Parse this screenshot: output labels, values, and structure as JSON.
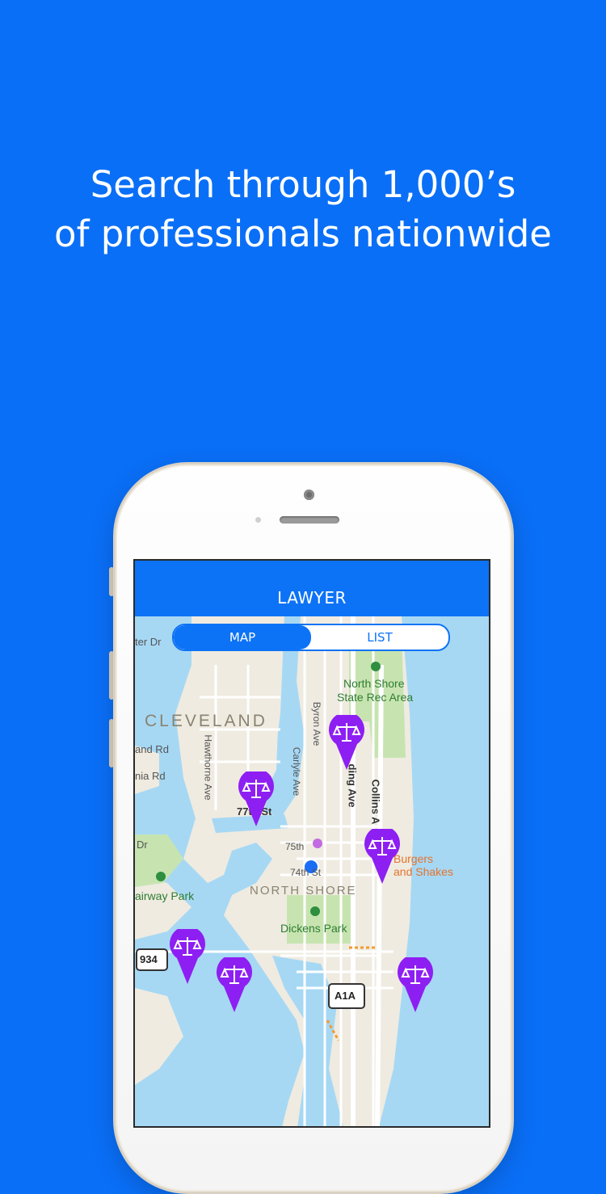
{
  "headline": {
    "line1": "Search through 1,000’s",
    "line2": "of professionals nationwide"
  },
  "app": {
    "title": "LAWYER",
    "segments": [
      {
        "label": "MAP",
        "selected": true
      },
      {
        "label": "LIST",
        "selected": false
      }
    ]
  },
  "map": {
    "labels": {
      "cleveland": "CLEVELAND",
      "north_shore": "NORTH SHORE",
      "park_north_shore": "North Shore",
      "park_state_rec": "State Rec Area",
      "dickens_park": "Dickens Park",
      "fairway_park": "airway Park",
      "burgers_1": "Burgers",
      "burgers_2": "and Shakes",
      "hawthorne": "Hawthorne Ave",
      "carlyle": "Carlyle Ave",
      "byron": "Byron Ave",
      "harding": "ding Ave",
      "collins": "Collins A",
      "st_77": "77th St",
      "st_75": "75th",
      "st_74": "74th St",
      "ter_dr": "ter Dr",
      "and_rd": "and Rd",
      "nia_rd": "nia Rd",
      "dr_left": "Dr",
      "shield_934": "934",
      "shield_a1a": "A1A"
    },
    "pin_icon": "scales-of-justice-icon",
    "pin_color": "#8e1ff2",
    "user_location_color": "#1a6ef5",
    "water_color": "#a6d8f4",
    "land_color": "#efebe1",
    "park_color": "#c7e4b0"
  }
}
